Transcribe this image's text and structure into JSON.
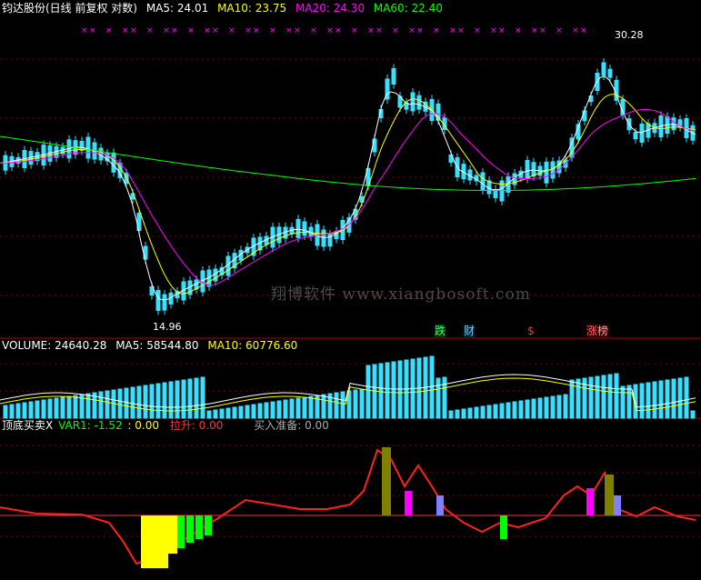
{
  "main_header": {
    "title": "钧达股份(日线 前复权 对数)",
    "ma5": "MA5: 24.01",
    "ma10": "MA10: 23.75",
    "ma20": "MA20: 24.30",
    "ma60": "MA60: 22.40",
    "colors": {
      "title": "#ffffff",
      "ma5": "#ffffff",
      "ma10": "#ffff00",
      "ma20": "#ff00ff",
      "ma60": "#00ff00"
    }
  },
  "price_marks": {
    "high": "30.28",
    "low": "14.96"
  },
  "watermark": "翔博软件 www.xiangbosoft.com",
  "event_tags": [
    {
      "text": "跌",
      "color": "#33ff66",
      "bg": "#003300"
    },
    {
      "text": "财",
      "color": "#66ccff",
      "bg": "#002233"
    },
    {
      "text": "$",
      "color": "#ff3333",
      "bg": "#000000"
    },
    {
      "text": "涨",
      "color": "#ff6666",
      "bg": "#330000"
    },
    {
      "text": "榜",
      "color": "#ff9999",
      "bg": "#330000"
    }
  ],
  "volume_header": {
    "volume": "VOLUME: 24640.28",
    "ma5": "MA5: 58544.80",
    "ma10": "MA10: 60776.60"
  },
  "indicator_header": {
    "title": "顶底买卖X",
    "var1": "VAR1: -1.52",
    "sep": ": 0.00",
    "lasheng": "拉升: 0.00",
    "buy_ready": "买入准备: 0.00"
  },
  "chart_data": [
    {
      "type": "candlestick",
      "title": "钧达股份(日线 前复权 对数)",
      "scale": "log",
      "price_range": [
        14.96,
        30.28
      ],
      "series": [
        {
          "name": "MA5",
          "value": 24.01,
          "color": "#ffffff"
        },
        {
          "name": "MA10",
          "value": 23.75,
          "color": "#ffff00"
        },
        {
          "name": "MA20",
          "value": 24.3,
          "color": "#ff00ff"
        },
        {
          "name": "MA60",
          "value": 22.4,
          "color": "#00ff00"
        }
      ],
      "annotations": [
        "30.28",
        "14.96"
      ]
    },
    {
      "type": "bar",
      "title": "VOLUME",
      "series": [
        {
          "name": "VOLUME",
          "value": 24640.28
        },
        {
          "name": "MA5",
          "value": 58544.8
        },
        {
          "name": "MA10",
          "value": 60776.6
        }
      ]
    },
    {
      "type": "bar",
      "title": "顶底买卖X",
      "series": [
        {
          "name": "VAR1",
          "value": -1.52
        },
        {
          "name": "拉升",
          "value": 0.0
        },
        {
          "name": "买入准备",
          "value": 0.0
        }
      ]
    }
  ]
}
